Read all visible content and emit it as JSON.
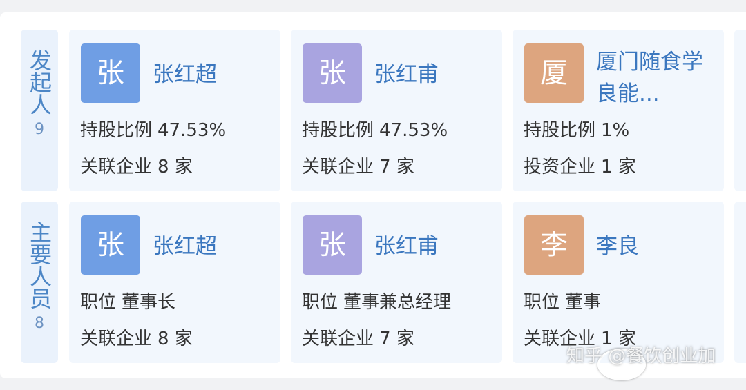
{
  "colors": {
    "avatar_blue": "#6f9ee4",
    "avatar_purple": "#a9a4e0",
    "avatar_orange": "#dda57f",
    "label_blue": "#4c86c6",
    "name_blue": "#3b77bf",
    "card_bg": "#f2f7fd",
    "side_bg": "#eaf2fc"
  },
  "founders": {
    "label": "发起人",
    "count": "9",
    "cards": [
      {
        "avatar": "张",
        "name": "张红超",
        "line1_key": "持股比例",
        "line1_val": "47.53%",
        "line2_key": "关联企业",
        "line2_val": "8 家"
      },
      {
        "avatar": "张",
        "name": "张红甫",
        "line1_key": "持股比例",
        "line1_val": "47.53%",
        "line2_key": "关联企业",
        "line2_val": "7 家"
      },
      {
        "avatar": "厦",
        "name": "厦门随食学良能...",
        "line1_key": "持股比例",
        "line1_val": "1%",
        "line2_key": "投资企业",
        "line2_val": "1 家"
      }
    ]
  },
  "staff": {
    "label": "主要人员",
    "count": "8",
    "cards": [
      {
        "avatar": "张",
        "name": "张红超",
        "line1_key": "职位",
        "line1_val": "董事长",
        "line2_key": "关联企业",
        "line2_val": "8 家"
      },
      {
        "avatar": "张",
        "name": "张红甫",
        "line1_key": "职位",
        "line1_val": "董事兼总经理",
        "line2_key": "关联企业",
        "line2_val": "7 家"
      },
      {
        "avatar": "李",
        "name": "李良",
        "line1_key": "职位",
        "line1_val": "董事",
        "line2_key": "关联企业",
        "line2_val": "1 家"
      }
    ]
  },
  "watermark": {
    "text": "知乎 @餐饮创业加"
  }
}
